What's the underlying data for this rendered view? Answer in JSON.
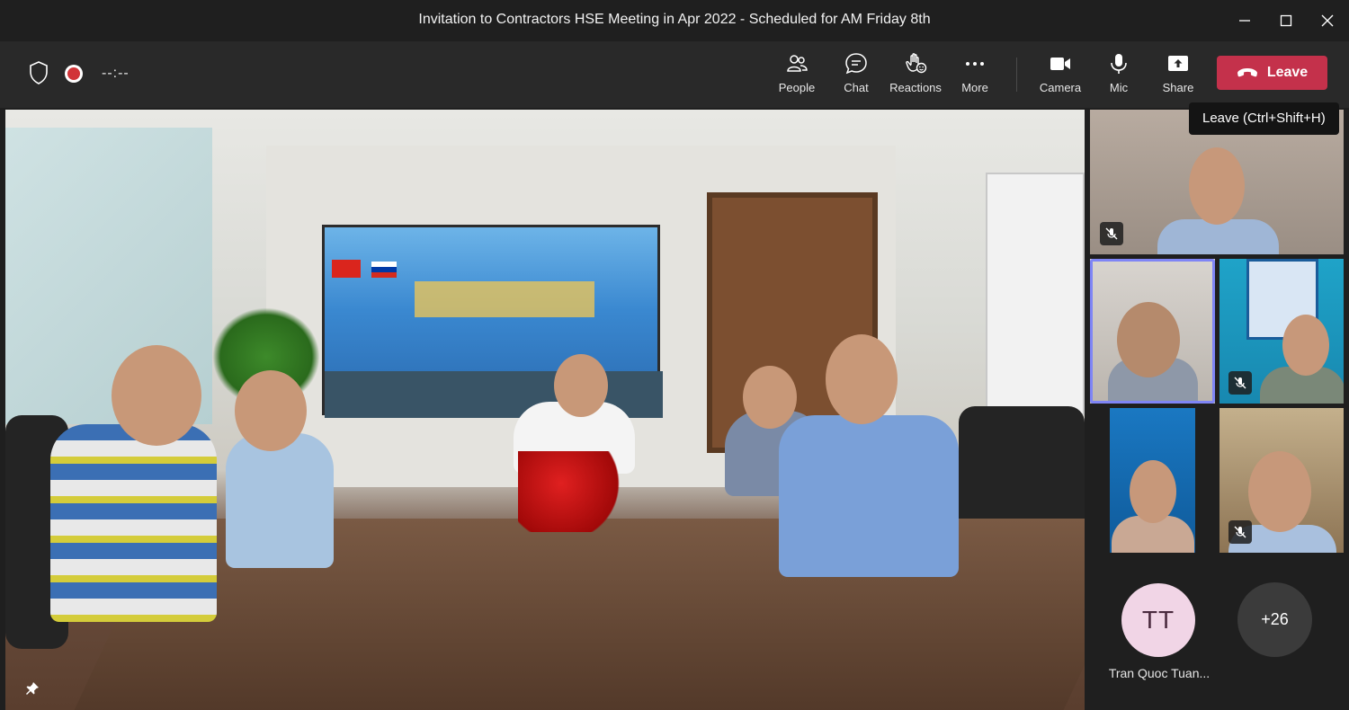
{
  "window": {
    "title": "Invitation to Contractors HSE Meeting in Apr 2022 - Scheduled for AM Friday 8th"
  },
  "toolbar": {
    "timer": "--:--",
    "buttons": [
      {
        "label": "People",
        "icon": "people-icon"
      },
      {
        "label": "Chat",
        "icon": "chat-icon"
      },
      {
        "label": "Reactions",
        "icon": "reactions-icon"
      },
      {
        "label": "More",
        "icon": "more-icon"
      },
      {
        "label": "Camera",
        "icon": "camera-icon"
      },
      {
        "label": "Mic",
        "icon": "mic-icon"
      },
      {
        "label": "Share",
        "icon": "share-icon"
      }
    ],
    "leave_label": "Leave",
    "leave_tooltip": "Leave (Ctrl+Shift+H)"
  },
  "participants": {
    "avatar_initials": "TT",
    "avatar_name": "Tran Quoc Tuan...",
    "overflow_count": "+26"
  },
  "colors": {
    "leave": "#c4314b",
    "active_speaker": "#7f85f5",
    "record": "#d13438"
  }
}
